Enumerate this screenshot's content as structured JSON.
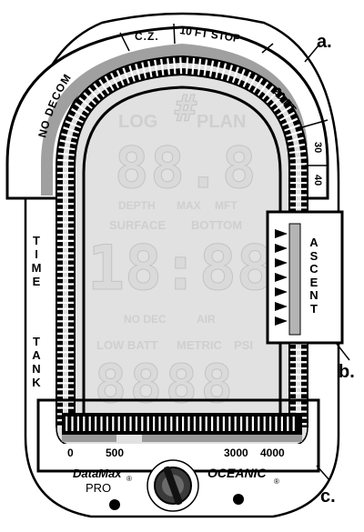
{
  "arc_labels": {
    "no_decom": "NO DECOM",
    "cz": "C.Z.",
    "stop10": "10 FT  STOP",
    "ft20": "20 FT",
    "n30": "30",
    "n40": "40"
  },
  "callouts": {
    "a": "a.",
    "b": "b.",
    "c": "c."
  },
  "lcd": {
    "icon": "#",
    "log": "LOG",
    "plan": "PLAN",
    "depth_digits": "88.8",
    "depth": "DEPTH",
    "max": "MAX",
    "mft": "MFT",
    "surface": "SURFACE",
    "bottom": "BOTTOM",
    "time_digits": "18:88",
    "nodec": "NO DEC",
    "air": "AIR",
    "lowbatt": "LOW BATT",
    "metric": "METRIC",
    "psi": "PSI",
    "tank_digits": "8888"
  },
  "side_labels": {
    "time": "T\nI\nM\nE",
    "tank": "T\nA\nN\nK",
    "ascent": "A\nS\nC\nE\nN\nT"
  },
  "scale": {
    "s0": "0",
    "s500": "500",
    "s3000": "3000",
    "s4000": "4000"
  },
  "brand": {
    "model": "DataMax",
    "sub": "PRO",
    "reg": "®",
    "maker": "OCEANIC",
    "reg2": "®"
  }
}
